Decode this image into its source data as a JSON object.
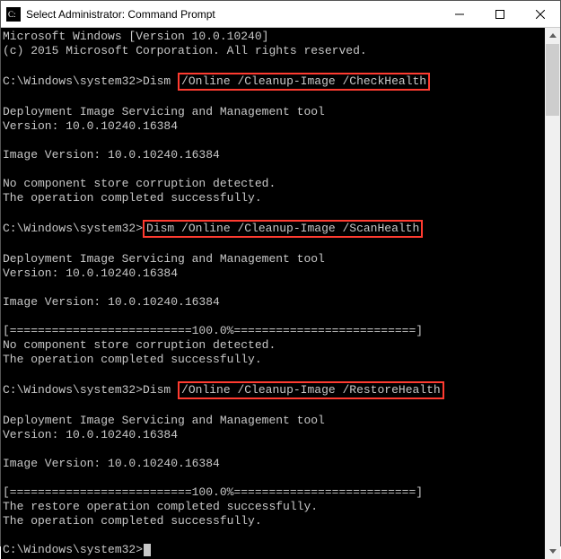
{
  "window": {
    "title": "Select Administrator: Command Prompt",
    "icon_name": "cmd-icon"
  },
  "terminal": {
    "header1": "Microsoft Windows [Version 10.0.10240]",
    "header2": "(c) 2015 Microsoft Corporation. All rights reserved.",
    "prompt": "C:\\Windows\\system32>",
    "dism_label": "Dism ",
    "cmd1_args": "/Online /Cleanup-Image /CheckHealth",
    "cmd2_full": "Dism /Online /Cleanup-Image /ScanHealth",
    "cmd3_args": "/Online /Cleanup-Image /RestoreHealth",
    "tool_line": "Deployment Image Servicing and Management tool",
    "tool_version": "Version: 10.0.10240.16384",
    "image_version": "Image Version: 10.0.10240.16384",
    "no_corruption": "No component store corruption detected.",
    "op_success": "The operation completed successfully.",
    "progress_bar": "[==========================100.0%==========================]",
    "restore_success": "The restore operation completed successfully."
  }
}
